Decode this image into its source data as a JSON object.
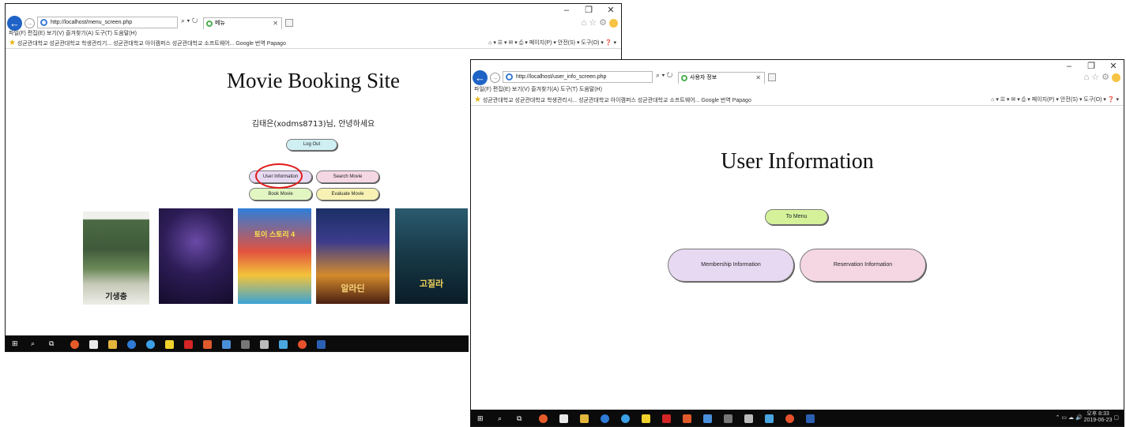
{
  "menu_window": {
    "address": "http://localhost/menu_screen.php",
    "address_host": "localhost",
    "tab_title": "메뉴",
    "menu_bar": "파일(F)  편집(E)  보기(V)  즐겨찾기(A)  도구(T)  도움말(H)",
    "favorites": "성균관대학교  성균관대학교 학생관리기...  성균관대학교 아이캠퍼스  성균관대학교 소프트웨어...  Google 번역  Papago",
    "toolbar_right": "페이지(P) ▾  안전(S) ▾  도구(O) ▾",
    "heading": "Movie Booking Site",
    "greeting": "김태은(xodms8713)님, 안녕하세요",
    "buttons": {
      "logout": "Log Out",
      "user_info": "User Information",
      "search_movie": "Search Movie",
      "book_movie": "Book Movie",
      "evaluate_movie": "Evaluate Movie"
    },
    "posters": [
      {
        "caption": "기생충"
      },
      {
        "caption": ""
      },
      {
        "caption": "토이 스토리 4"
      },
      {
        "caption": "알라딘"
      },
      {
        "caption": "고질라"
      }
    ]
  },
  "user_window": {
    "address": "http://localhost/user_info_screen.php",
    "address_host": "localhost",
    "tab_title": "사용자 정보",
    "menu_bar": "파일(F)  편집(E)  보기(V)  즐겨찾기(A)  도구(T)  도움말(H)",
    "favorites": "성균관대학교  성균관대학교 학생관리시...  성균관대학교 아이캠퍼스  성균관대학교 소프트웨어...  Google 번역  Papago",
    "toolbar_right": "페이지(P) ▾  안전(S) ▾  도구(O) ▾",
    "heading": "User Information",
    "buttons": {
      "to_menu": "To Menu",
      "membership": "Membership Information",
      "reservation": "Reservation Information"
    },
    "clock_time": "오후 8:33",
    "clock_date": "2019-06-23"
  },
  "colors": {
    "ie_blue": "#1f63c6",
    "highlight_ring": "#e11a1a",
    "taskbar": "#0b0b0b"
  }
}
